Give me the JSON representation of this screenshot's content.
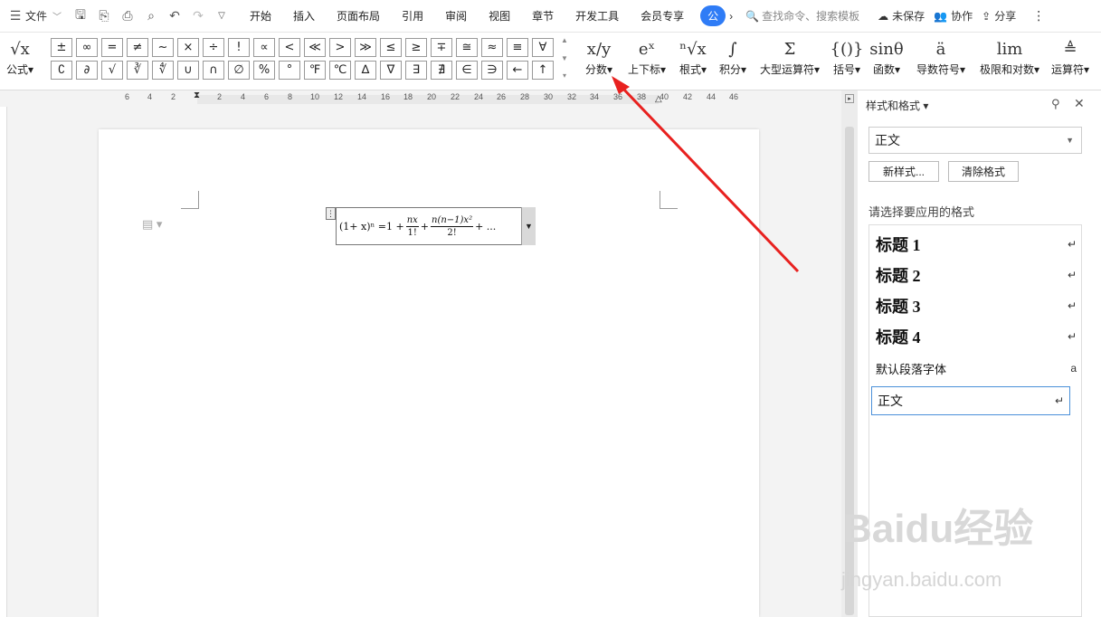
{
  "menubar": {
    "menu_label": "文件",
    "tabs": [
      "开始",
      "插入",
      "页面布局",
      "引用",
      "审阅",
      "视图",
      "章节",
      "开发工具",
      "会员专享"
    ],
    "active_tab": "公",
    "search_placeholder": "查找命令、搜索模板",
    "unsaved": "未保存",
    "collab": "协作",
    "share": "分享"
  },
  "ribbon": {
    "formula_label": "公式",
    "symbols_row1": [
      "±",
      "∞",
      "=",
      "≠",
      "~",
      "×",
      "÷",
      "!",
      "∝",
      "<",
      "≪",
      ">",
      "≫",
      "≤",
      "≥",
      "∓",
      "≅",
      "≈",
      "≡",
      "∀"
    ],
    "symbols_row2": [
      "∁",
      "∂",
      "√",
      "∛",
      "∜",
      "∪",
      "∩",
      "∅",
      "%",
      "°",
      "℉",
      "℃",
      "∆",
      "∇",
      "∃",
      "∄",
      "∈",
      "∋",
      "←",
      "↑"
    ],
    "groups": [
      {
        "label": "分数",
        "icon": "x/y"
      },
      {
        "label": "上下标",
        "icon": "eˣ"
      },
      {
        "label": "根式",
        "icon": "ⁿ√x"
      },
      {
        "label": "积分",
        "icon": "∫"
      },
      {
        "label": "大型运算符",
        "icon": "Σ"
      },
      {
        "label": "括号",
        "icon": "{()}"
      },
      {
        "label": "函数",
        "icon": "sinθ"
      },
      {
        "label": "导数符号",
        "icon": "ä"
      },
      {
        "label": "极限和对数",
        "icon": "lim"
      },
      {
        "label": "运算符",
        "icon": "≜"
      }
    ]
  },
  "ruler": {
    "numbers": [
      "6",
      "4",
      "2",
      "2",
      "4",
      "6",
      "8",
      "10",
      "12",
      "14",
      "16",
      "18",
      "20",
      "22",
      "24",
      "26",
      "28",
      "30",
      "32",
      "34",
      "36",
      "38",
      "40",
      "42",
      "44",
      "46"
    ]
  },
  "equation": {
    "lhs": "(1+ x)ⁿ =1 +",
    "frac1_num": "nx",
    "frac1_den": "1!",
    "plus": "+",
    "frac2_num": "n(n−1)x²",
    "frac2_den": "2!",
    "tail": "+ ..."
  },
  "sidepanel": {
    "title": "样式和格式",
    "current_style": "正文",
    "new_style": "新样式...",
    "clear_format": "清除格式",
    "choose_label": "请选择要应用的格式",
    "styles": [
      {
        "name": "标题 1",
        "mark": "↵"
      },
      {
        "name": "标题 2",
        "mark": "↵"
      },
      {
        "name": "标题 3",
        "mark": "↵"
      },
      {
        "name": "标题 4",
        "mark": "↵"
      },
      {
        "name": "默认段落字体",
        "mark": "a"
      },
      {
        "name": "正文",
        "mark": "↵"
      }
    ]
  },
  "watermark": {
    "brand": "Baidu经验",
    "url": "jingyan.baidu.com"
  },
  "annotation": {
    "arrow_color": "#e8211f"
  }
}
